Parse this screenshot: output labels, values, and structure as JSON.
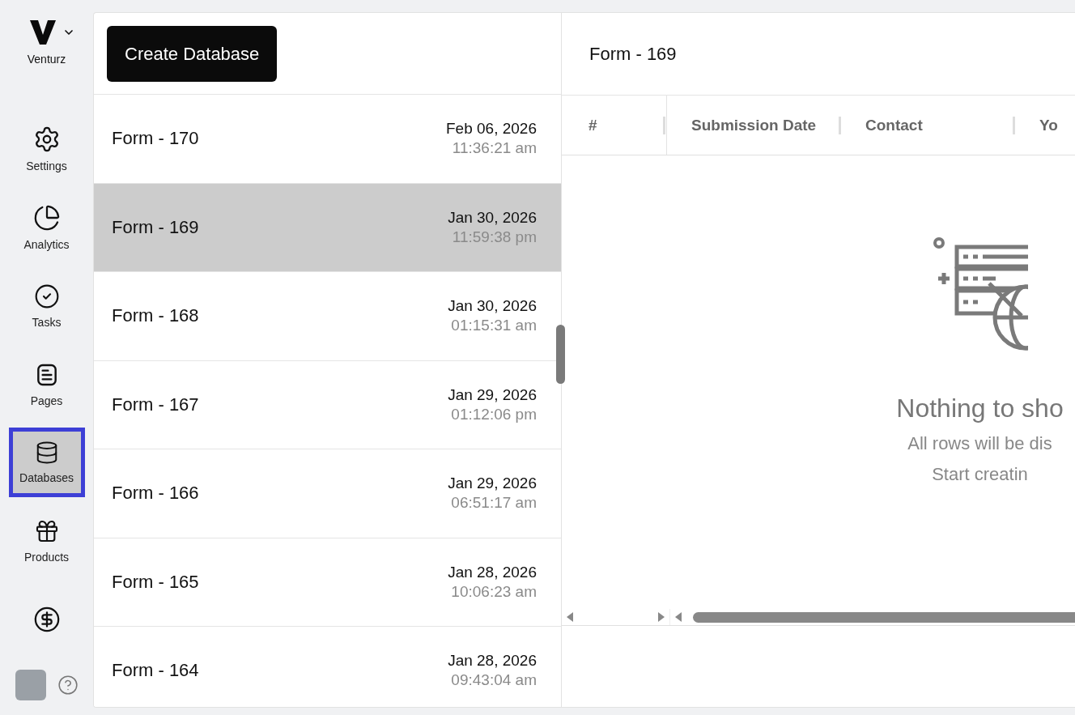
{
  "brand": {
    "name": "Venturz"
  },
  "nav": [
    {
      "label": "Settings",
      "kind": "settings",
      "selected": false
    },
    {
      "label": "Analytics",
      "kind": "analytics",
      "selected": false
    },
    {
      "label": "Tasks",
      "kind": "tasks",
      "selected": false
    },
    {
      "label": "Pages",
      "kind": "pages",
      "selected": false
    },
    {
      "label": "Databases",
      "kind": "databases",
      "selected": true
    },
    {
      "label": "Products",
      "kind": "products",
      "selected": false
    },
    {
      "kind": "billing",
      "selected": false
    }
  ],
  "create_button": "Create Database",
  "forms": [
    {
      "name": "Form - 170",
      "date": "Feb 06, 2026",
      "time": "11:36:21 am",
      "selected": false
    },
    {
      "name": "Form - 169",
      "date": "Jan 30, 2026",
      "time": "11:59:38 pm",
      "selected": true
    },
    {
      "name": "Form - 168",
      "date": "Jan 30, 2026",
      "time": "01:15:31 am",
      "selected": false
    },
    {
      "name": "Form - 167",
      "date": "Jan 29, 2026",
      "time": "01:12:06 pm",
      "selected": false
    },
    {
      "name": "Form - 166",
      "date": "Jan 29, 2026",
      "time": "06:51:17 am",
      "selected": false
    },
    {
      "name": "Form - 165",
      "date": "Jan 28, 2026",
      "time": "10:06:23 am",
      "selected": false
    },
    {
      "name": "Form - 164",
      "date": "Jan 28, 2026",
      "time": "09:43:04 am",
      "selected": false
    }
  ],
  "detail": {
    "title": "Form - 169",
    "columns": [
      "#",
      "Submission Date",
      "Contact",
      "Yo"
    ],
    "empty": {
      "title": "Nothing to sho",
      "lines": [
        "All rows will be dis",
        "Start creatin"
      ]
    }
  }
}
